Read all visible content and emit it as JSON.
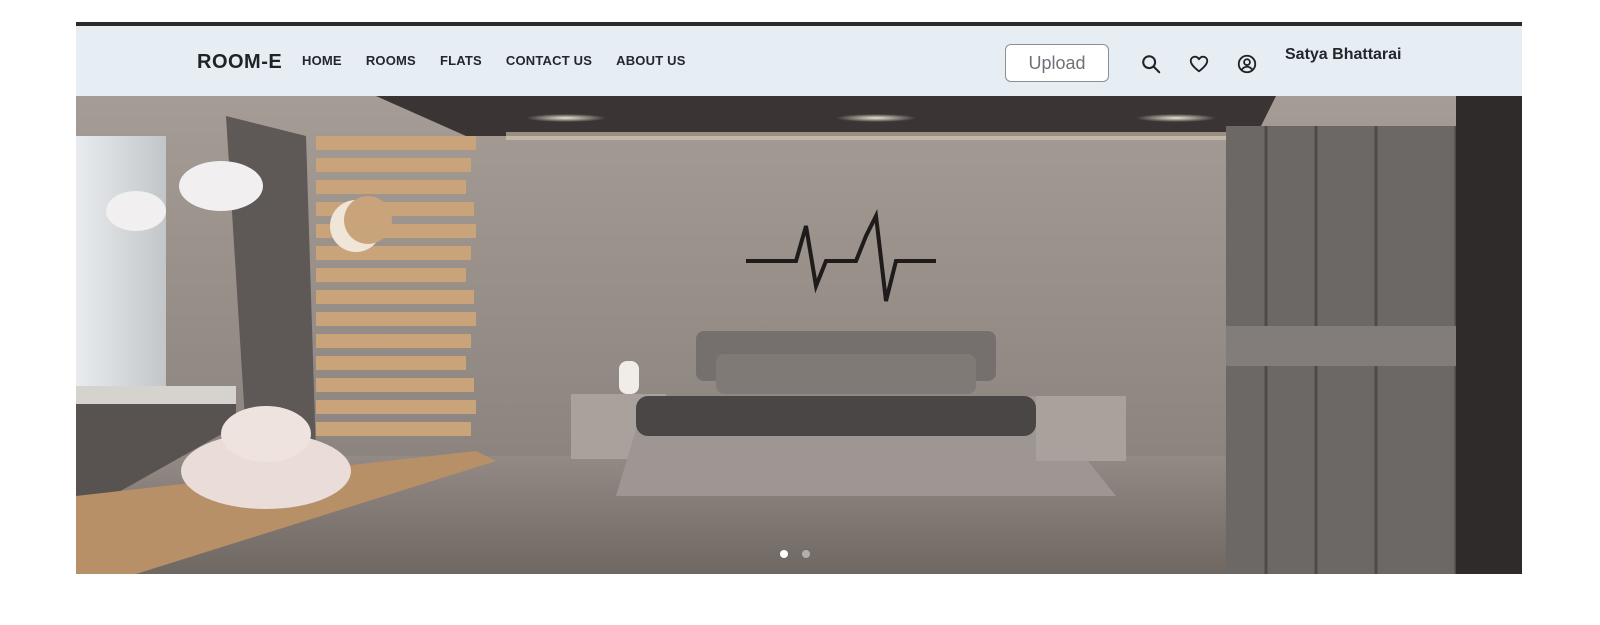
{
  "navbar": {
    "brand": "ROOM-E",
    "links": [
      "HOME",
      "ROOMS",
      "FLATS",
      "CONTACT US",
      "ABOUT US"
    ],
    "upload_label": "Upload",
    "icons": [
      "search-icon",
      "heart-icon",
      "user-circle-icon"
    ],
    "user_name": "Satya Bhattarai"
  },
  "hero": {
    "image": "bedroom-interior-photo",
    "carousel": {
      "slides": 2,
      "active": 1
    }
  },
  "colors": {
    "navbar_bg": "#e6edf3",
    "wall": "#8e8782",
    "wood": "#c9a47b"
  }
}
